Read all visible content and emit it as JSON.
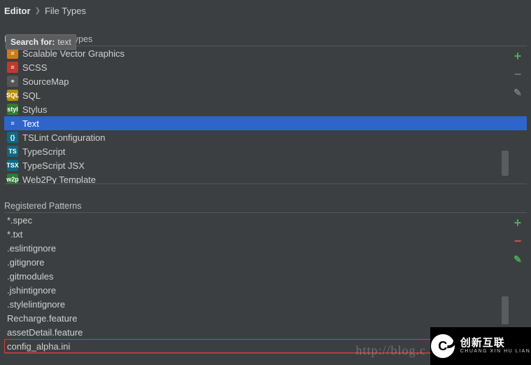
{
  "breadcrumb": {
    "root": "Editor",
    "current": "File Types"
  },
  "search": {
    "label": "Search for:",
    "query": "text"
  },
  "section_filetypes_title": "Recognized File Types",
  "filetypes": {
    "items": [
      {
        "icon": "svg",
        "label": "Scalable Vector Graphics",
        "selected": false
      },
      {
        "icon": "scss",
        "label": "SCSS",
        "selected": false
      },
      {
        "icon": "map",
        "label": "SourceMap",
        "selected": false
      },
      {
        "icon": "sql",
        "label": "SQL",
        "selected": false
      },
      {
        "icon": "styl",
        "label": "Stylus",
        "selected": false
      },
      {
        "icon": "text",
        "label": "Text",
        "selected": true
      },
      {
        "icon": "tsl",
        "label": "TSLint Configuration",
        "selected": false
      },
      {
        "icon": "ts",
        "label": "TypeScript",
        "selected": false
      },
      {
        "icon": "tsx",
        "label": "TypeScript JSX",
        "selected": false
      },
      {
        "icon": "w2p",
        "label": "Web2Py Template",
        "selected": false
      }
    ]
  },
  "section_patterns_title": "Registered Patterns",
  "patterns": {
    "items": [
      {
        "label": "*.spec"
      },
      {
        "label": "*.txt"
      },
      {
        "label": ".eslintignore"
      },
      {
        "label": ".gitignore"
      },
      {
        "label": ".gitmodules"
      },
      {
        "label": ".jshintignore"
      },
      {
        "label": ".stylelintignore"
      },
      {
        "label": "Recharge.feature"
      },
      {
        "label": "assetDetail.feature"
      },
      {
        "label": "config_alpha.ini",
        "highlight": true
      }
    ]
  },
  "icon_glyphs": {
    "svg": "≡",
    "scss": "≡",
    "map": "⌖",
    "sql": "SQL",
    "styl": "styl",
    "text": "≡",
    "tsl": "{}",
    "ts": "TS",
    "tsx": "TSX",
    "w2p": "w2p"
  },
  "watermark": "http://blog.c",
  "logo": {
    "cn": "创新互联",
    "en": "CHUANG XIN HU LIAN"
  }
}
